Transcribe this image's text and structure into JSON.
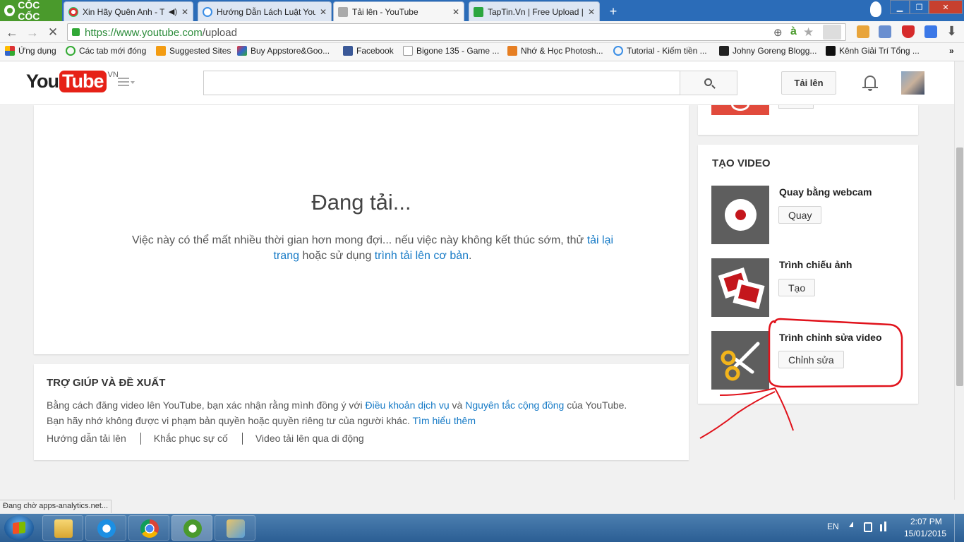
{
  "browser": {
    "brand": "CỐC CỐC",
    "tabs": [
      {
        "label": "Xin Hãy Quên Anh - Trị",
        "active": false,
        "audio": true
      },
      {
        "label": "Hướng Dẫn Lách Luật You",
        "active": false
      },
      {
        "label": "Tải lên - YouTube",
        "active": true
      },
      {
        "label": "TapTin.Vn | Free Upload | F",
        "active": false
      }
    ],
    "url_secure": "https://www.youtube.com",
    "url_path": "/upload",
    "bookmarks": [
      "Ứng dụng",
      "Các tab mới đóng",
      "Suggested Sites",
      "Buy Appstore&Goo...",
      "Facebook",
      "Bigone 135 - Game ...",
      "Nhớ & Học Photosh...",
      "Tutorial - Kiếm tiền ...",
      "Johny Goreng Blogg...",
      "Kênh Giải Trí Tổng ..."
    ]
  },
  "youtube": {
    "logo_you": "You",
    "logo_tube": "Tube",
    "logo_region": "VN",
    "search_placeholder": "",
    "upload_label": "Tải lên"
  },
  "loading": {
    "title": "Đang tải...",
    "msg_before": "Việc này có thể mất nhiều thời gian hơn mong đợi... nếu việc này không kết thúc sớm, thử ",
    "reload_link": "tải lại trang",
    "msg_middle": " hoặc sử dụng ",
    "basic_link": "trình tải lên cơ bản",
    "msg_end": "."
  },
  "help": {
    "title": "TRỢ GIÚP VÀ ĐỀ XUẤT",
    "text_1": "Bằng cách đăng video lên YouTube, bạn xác nhận rằng mình đồng ý với ",
    "terms_link": "Điều khoản dịch vụ",
    "text_2": " và ",
    "guidelines_link": "Nguyên tắc cộng đồng",
    "text_3": " của YouTube.",
    "text_4": "Bạn hãy nhớ không được vi phạm bản quyền hoặc quyền riêng tư của người khác. ",
    "learn_more_link": "Tìm hiểu thêm",
    "links": [
      "Hướng dẫn tải lên",
      "Khắc phục sự cố",
      "Video tải lên qua di động"
    ]
  },
  "create_video": {
    "title": "TẠO VIDEO",
    "items": [
      {
        "title": "Quay bằng webcam",
        "button": "Quay"
      },
      {
        "title": "Trình chiếu ảnh",
        "button": "Tạo"
      },
      {
        "title": "Trình chỉnh sửa video",
        "button": "Chỉnh sửa"
      }
    ]
  },
  "status": "Đang chờ apps-analytics.net...",
  "taskbar": {
    "language": "EN",
    "time": "2:07 PM",
    "date": "15/01/2015"
  },
  "colors": {
    "annotation": "#e0121b",
    "youtube_red": "#e62117",
    "link": "#167ac6"
  }
}
